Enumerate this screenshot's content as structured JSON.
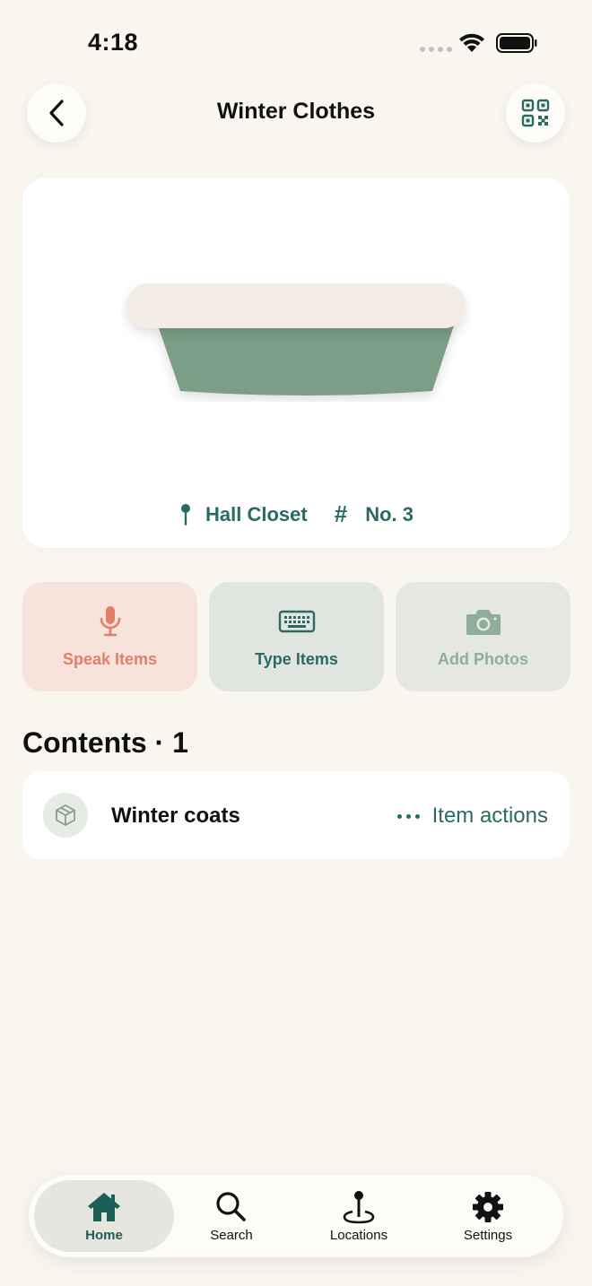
{
  "status_bar": {
    "time": "4:18"
  },
  "header": {
    "title": "Winter Clothes"
  },
  "hero": {
    "location": "Hall Closet",
    "number": "No. 3"
  },
  "actions": [
    {
      "label": "Speak Items"
    },
    {
      "label": "Type Items"
    },
    {
      "label": "Add Photos"
    }
  ],
  "contents": {
    "heading": "Contents · 1",
    "items": [
      {
        "name": "Winter coats",
        "action_label": "Item actions"
      }
    ]
  },
  "tab_bar": [
    {
      "label": "Home"
    },
    {
      "label": "Search"
    },
    {
      "label": "Locations"
    },
    {
      "label": "Settings"
    }
  ],
  "colors": {
    "background": "#f9f6f0",
    "accent": "#2b6a63",
    "speak": "#e17f6a",
    "bin_green": "#7b9e86",
    "bin_lid": "#f3ede6"
  }
}
